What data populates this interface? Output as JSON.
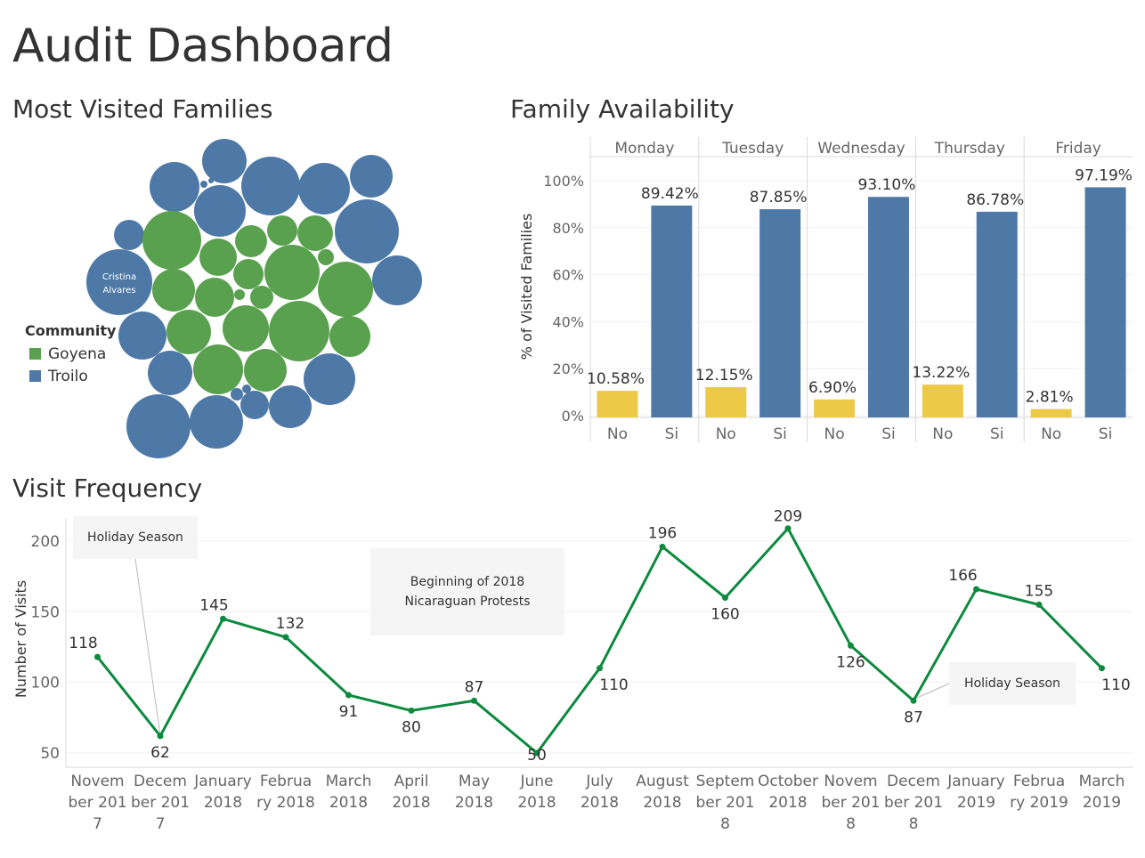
{
  "dashboard": {
    "title": "Audit Dashboard"
  },
  "sections": {
    "bubble_title": "Most Visited Families",
    "availability_title": "Family Availability",
    "frequency_title": "Visit Frequency"
  },
  "legend": {
    "title": "Community",
    "items": [
      {
        "label": "Goyena",
        "color": "#59a14f"
      },
      {
        "label": "Troilo",
        "color": "#4e79a7"
      }
    ]
  },
  "bubble_label": {
    "line1": "Cristina",
    "line2": "Alvares"
  },
  "colors": {
    "troilo": "#4e79a7",
    "goyena": "#59a14f",
    "no_bar": "#edc948",
    "line": "#0c8a3e"
  },
  "chart_data": [
    {
      "type": "bar",
      "title": "Family Availability",
      "ylabel": "% of Visited Families",
      "ylim": [
        0,
        100
      ],
      "yticks": [
        "0%",
        "20%",
        "40%",
        "60%",
        "80%",
        "100%"
      ],
      "panels": [
        "Monday",
        "Tuesday",
        "Wednesday",
        "Thursday",
        "Friday"
      ],
      "categories": [
        "No",
        "Si"
      ],
      "values": {
        "No": [
          10.58,
          12.15,
          6.9,
          13.22,
          2.81
        ],
        "Si": [
          89.42,
          87.85,
          93.1,
          86.78,
          97.19
        ]
      },
      "labels": {
        "No": [
          "10.58%",
          "12.15%",
          "6.90%",
          "13.22%",
          "2.81%"
        ],
        "Si": [
          "89.42%",
          "87.85%",
          "93.10%",
          "86.78%",
          "97.19%"
        ]
      },
      "colors": {
        "No": "#edc948",
        "Si": "#4e79a7"
      }
    },
    {
      "type": "line",
      "title": "Visit Frequency",
      "ylabel": "Number of Visits",
      "yticks": [
        50,
        100,
        150,
        200
      ],
      "ylim": [
        40,
        215
      ],
      "x": [
        [
          "Novem",
          "ber 201",
          "7"
        ],
        [
          "Decem",
          "ber 201",
          "7"
        ],
        [
          "January",
          "2018"
        ],
        [
          "Februa",
          "ry 2018"
        ],
        [
          "March",
          "2018"
        ],
        [
          "April",
          "2018"
        ],
        [
          "May",
          "2018"
        ],
        [
          "June",
          "2018"
        ],
        [
          "July",
          "2018"
        ],
        [
          "August",
          "2018"
        ],
        [
          "Septem",
          "ber 201",
          "8"
        ],
        [
          "October",
          "2018"
        ],
        [
          "Novem",
          "ber 201",
          "8"
        ],
        [
          "Decem",
          "ber 201",
          "8"
        ],
        [
          "January",
          "2019"
        ],
        [
          "Februa",
          "ry 2019"
        ],
        [
          "March",
          "2019"
        ]
      ],
      "values": [
        118,
        62,
        145,
        132,
        91,
        80,
        87,
        50,
        110,
        196,
        160,
        209,
        126,
        87,
        166,
        155,
        110
      ],
      "annotations": [
        {
          "text": "Holiday Season"
        },
        {
          "text": "Beginning of 2018 Nicaraguan Protests"
        },
        {
          "text": "Holiday Season"
        }
      ]
    }
  ]
}
